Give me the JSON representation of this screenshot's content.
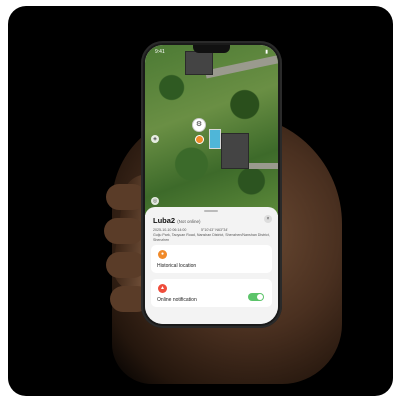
{
  "status_bar": {
    "time": "9:41",
    "battery": "▮"
  },
  "map": {
    "mower_icon": "mower-icon",
    "location_pin_icon": "location-pin-icon",
    "layers_icon": "layers-icon",
    "recenter_icon": "recenter-icon"
  },
  "device_sheet": {
    "device_name": "Luba2",
    "device_status": "(Not online)",
    "close_glyph": "×",
    "timestamp": "2025-10-10 06:14:00",
    "coordinates": "5°10'43\" N63°34'",
    "address": "Guiju Park, Taoyuan Road, Nanshan District, Shenzhen/Nanshan District, Shenzhen",
    "historical_location": {
      "label": "Historical location",
      "icon": "location-pin-icon",
      "color": "#f08a2a"
    },
    "online_notification": {
      "label": "Online notification",
      "icon": "bell-icon",
      "color": "#ef4d3c",
      "enabled": true
    }
  },
  "colors": {
    "toggle_on": "#5cc46a",
    "sheet_bg": "#f3f3f3"
  }
}
